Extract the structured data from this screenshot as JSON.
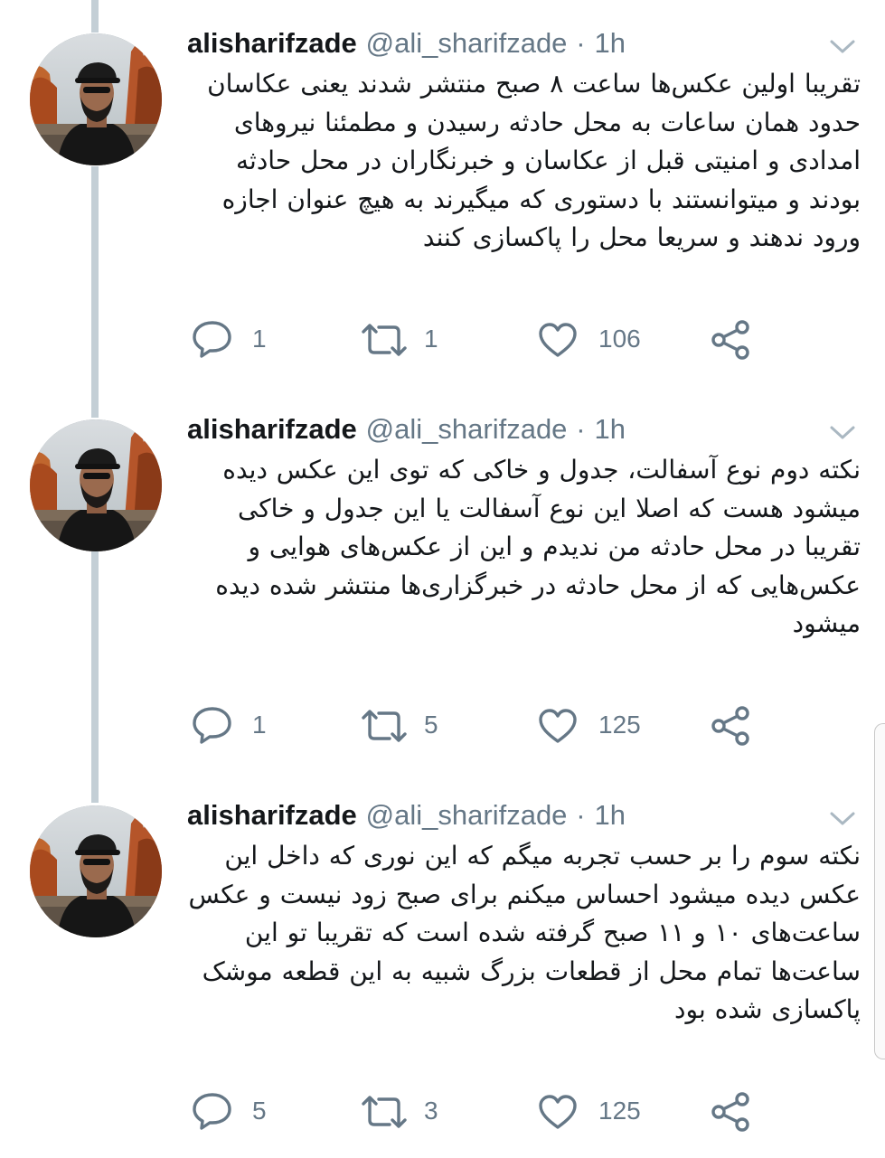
{
  "theme": {
    "text": "#14171a",
    "muted": "#657786",
    "thread_line": "#c4cfd6"
  },
  "tweets": [
    {
      "username": "alisharifzade",
      "handle": "@ali_sharifzade",
      "separator": "·",
      "time": "1h",
      "lines": [
        "تقریبا اولین عکس‌ها ساعت ۸ صبح منتشر شدند یعنی عکاسان",
        "حدود همان ساعات به محل حادثه رسیدن و مطمئنا نیروهای",
        "امدادی و امنیتی قبل از عکاسان و خبرنگاران در محل حادثه",
        "بودند و میتوانستند با دستوری که میگیرند به هیچ عنوان اجازه",
        "ورود ندهند و سریعا محل را پاکسازی کنند"
      ],
      "replies": "1",
      "retweets": "1",
      "likes": "106"
    },
    {
      "username": "alisharifzade",
      "handle": "@ali_sharifzade",
      "separator": "·",
      "time": "1h",
      "lines": [
        "نکته دوم نوع آسفالت، جدول و خاکی که توی این عکس دیده",
        "میشود هست که اصلا این نوع آسفالت یا این جدول و خاکی",
        "تقریبا در محل حادثه من ندیدم و این از عکس‌های هوایی و",
        "عکس‌هایی که از محل حادثه در خبرگزاری‌ها منتشر شده دیده",
        "میشود"
      ],
      "replies": "1",
      "retweets": "5",
      "likes": "125"
    },
    {
      "username": "alisharifzade",
      "handle": "@ali_sharifzade",
      "separator": "·",
      "time": "1h",
      "lines": [
        "نکته سوم را بر حسب تجربه میگم که این نوری که داخل این",
        "عکس دیده میشود احساس میکنم برای صبح زود نیست و عکس",
        "ساعت‌های ۱۰ و ۱۱ صبح گرفته شده است که تقریبا تو این",
        "ساعت‌ها تمام محل از قطعات بزرگ شبیه به این قطعه موشک",
        "پاکسازی شده بود"
      ],
      "replies": "5",
      "retweets": "3",
      "likes": "125"
    }
  ]
}
